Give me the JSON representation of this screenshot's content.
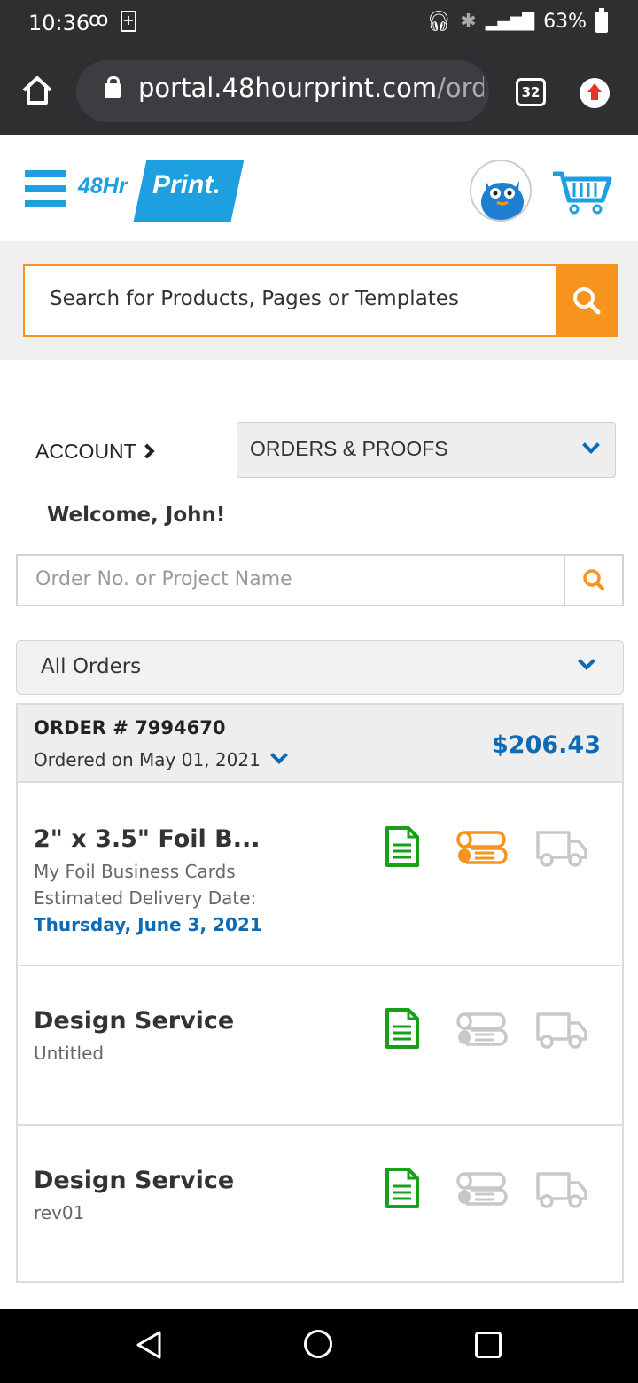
{
  "status_bar": {
    "time": "10:36",
    "battery": "63%"
  },
  "browser": {
    "url_main": "portal.48hourprint.com",
    "url_dim": "/ord",
    "tab_count": "32"
  },
  "header": {
    "logo_part1": "48Hr",
    "logo_part2": "Print."
  },
  "search": {
    "placeholder": "Search for Products, Pages or Templates"
  },
  "account": {
    "label": "ACCOUNT",
    "section_select": "ORDERS & PROOFS",
    "welcome": "Welcome, John!"
  },
  "order_search": {
    "placeholder": "Order No. or Project Name"
  },
  "filter": {
    "selected": "All Orders"
  },
  "order": {
    "number": "ORDER # 7994670",
    "date": "Ordered on May 01, 2021",
    "total": "$206.43",
    "items": [
      {
        "title": "2\" x 3.5\" Foil B...",
        "subtitle": "My Foil Business Cards",
        "delivery_label": "Estimated Delivery Date:",
        "delivery_date": "Thursday, June 3, 2021"
      },
      {
        "title": "Design Service",
        "subtitle": "Untitled"
      },
      {
        "title": "Design Service",
        "subtitle": "rev01"
      }
    ]
  },
  "colors": {
    "brand_blue": "#1e9fe0",
    "accent_orange": "#f7941d",
    "link_blue": "#0d6bb5",
    "proof_green": "#1a9f1a",
    "inactive_gray": "#c8c8c8"
  }
}
